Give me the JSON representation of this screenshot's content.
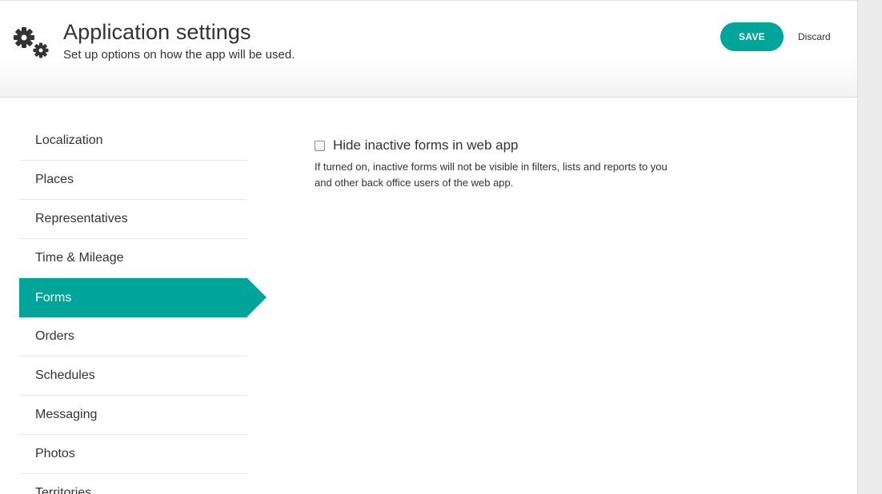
{
  "header": {
    "icon": "gears-icon",
    "title": "Application settings",
    "subtitle": "Set up options on how the app will be used.",
    "save_label": "SAVE",
    "discard_label": "Discard"
  },
  "colors": {
    "accent": "#00a599"
  },
  "sidebar": {
    "active_index": 4,
    "items": [
      {
        "label": "Localization"
      },
      {
        "label": "Places"
      },
      {
        "label": "Representatives"
      },
      {
        "label": "Time & Mileage"
      },
      {
        "label": "Forms"
      },
      {
        "label": "Orders"
      },
      {
        "label": "Schedules"
      },
      {
        "label": "Messaging"
      },
      {
        "label": "Photos"
      },
      {
        "label": "Territories"
      }
    ]
  },
  "forms_settings": {
    "hide_inactive": {
      "label": "Hide inactive forms in web app",
      "checked": false,
      "help": "If turned on, inactive forms will not be visible in filters, lists and reports to you and other back office users of the web app."
    }
  }
}
